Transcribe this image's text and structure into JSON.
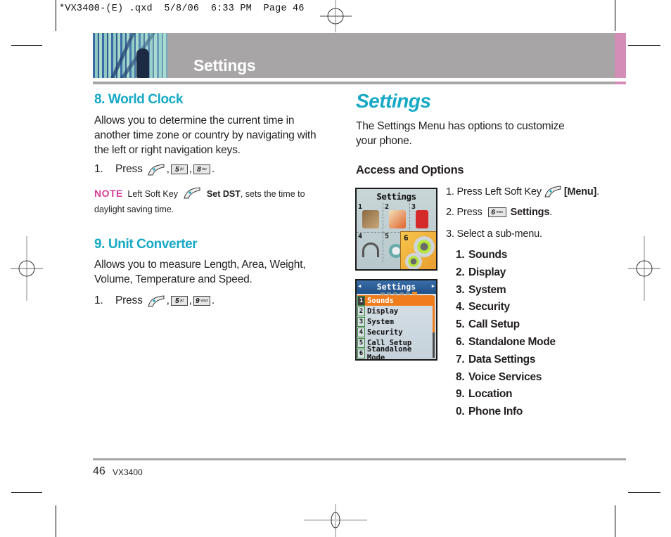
{
  "print_slug": "*VX3400-(E) .qxd  5/8/06  6:33 PM  Page 46",
  "header": {
    "section_title": "Settings",
    "colors": {
      "band": "#a7a5a6",
      "accent_pink": "#d48db6"
    }
  },
  "left_column": {
    "world_clock": {
      "heading": "8. World Clock",
      "description": "Allows you to determine the current time in another time zone or country by navigating with the left or right navigation keys.",
      "step": {
        "number": "1.",
        "label": "Press",
        "keys": [
          "left-soft-key",
          "5 jkl",
          "8 tuv"
        ]
      },
      "note": {
        "label": "NOTE",
        "text_before": "Left Soft Key",
        "bold_text": "Set DST",
        "text_after": ", sets the time to daylight saving time."
      }
    },
    "unit_converter": {
      "heading": "9. Unit Converter",
      "description": "Allows you to measure Length, Area, Weight, Volume, Temperature and Speed.",
      "step": {
        "number": "1.",
        "label": "Press",
        "keys": [
          "left-soft-key",
          "5 jkl",
          "9 wxyz"
        ]
      }
    }
  },
  "right_column": {
    "title": "Settings",
    "intro": "The Settings Menu has options to customize your phone.",
    "access_heading": "Access and Options",
    "steps": [
      {
        "text": "1. Press Left Soft Key",
        "bold": "[Menu]",
        "suffix": "."
      },
      {
        "text": "2. Press",
        "key": "6 mno",
        "bold": "Settings",
        "suffix": "."
      },
      {
        "text": "3. Select a sub-menu."
      }
    ],
    "menu_items": [
      {
        "num": "1.",
        "label": "Sounds"
      },
      {
        "num": "2.",
        "label": "Display"
      },
      {
        "num": "3.",
        "label": "System"
      },
      {
        "num": "4.",
        "label": "Security"
      },
      {
        "num": "5.",
        "label": "Call Setup"
      },
      {
        "num": "6.",
        "label": "Standalone Mode"
      },
      {
        "num": "7.",
        "label": "Data Settings"
      },
      {
        "num": "8.",
        "label": "Voice Services"
      },
      {
        "num": "9.",
        "label": "Location"
      },
      {
        "num": "0.",
        "label": "Phone Info"
      }
    ]
  },
  "phone_screen_grid": {
    "title": "Settings",
    "cells": [
      "1",
      "2",
      "3",
      "4",
      "5",
      "6"
    ],
    "selected": "6"
  },
  "phone_screen_list": {
    "title": "Settings",
    "rows": [
      {
        "n": "1",
        "label": "Sounds"
      },
      {
        "n": "2",
        "label": "Display"
      },
      {
        "n": "3",
        "label": "System"
      },
      {
        "n": "4",
        "label": "Security"
      },
      {
        "n": "5",
        "label": "Call Setup"
      },
      {
        "n": "6",
        "label": "Standalone Mode"
      }
    ],
    "highlight_color": "#f07c1c"
  },
  "footer": {
    "page_number": "46",
    "model": "VX3400"
  },
  "keys": {
    "k5": "5",
    "k5s": "jkl",
    "k8": "8",
    "k8s": "tuv",
    "k9": "9",
    "k9s": "wxyz",
    "k6": "6",
    "k6s": "mno"
  }
}
